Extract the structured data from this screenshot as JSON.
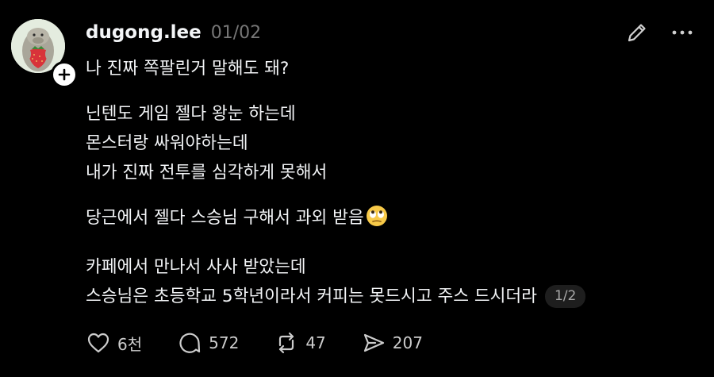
{
  "post": {
    "username": "dugong.lee",
    "date": "01/02",
    "paragraphs": [
      [
        "나 진짜 쪽팔린거 말해도 돼?"
      ],
      [
        "닌텐도 게임 젤다 왕눈 하는데",
        "몬스터랑 싸워야하는데",
        "내가 진짜 전투를 심각하게 못해서"
      ],
      [
        "당근에서 젤다 스승님 구해서 과외 받음"
      ],
      [
        "카페에서 만나서 사사 받았는데",
        "스승님은 초등학교 5학년이라서 커피는 못드시고 주스 드시더라"
      ]
    ],
    "emoji": "eye-roll-emoji",
    "page_indicator": "1/2"
  },
  "actions": {
    "like": {
      "icon": "heart-icon",
      "count": "6천"
    },
    "reply": {
      "icon": "comment-icon",
      "count": "572"
    },
    "repost": {
      "icon": "repost-icon",
      "count": "47"
    },
    "share": {
      "icon": "send-icon",
      "count": "207"
    }
  },
  "header_icons": {
    "edit": "pencil-icon",
    "more": "more-icon"
  },
  "colors": {
    "background": "#000000",
    "text": "#f3f5f7",
    "muted": "#777777"
  }
}
